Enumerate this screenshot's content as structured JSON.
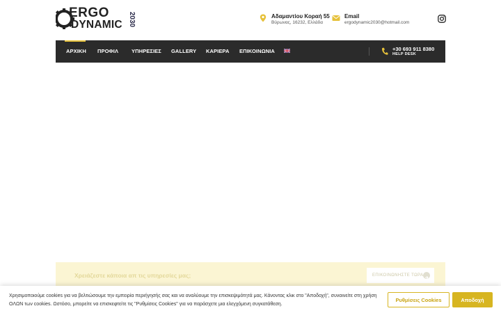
{
  "brand": {
    "line1": "ERGO",
    "line2": "DYNAMIC",
    "year": "2030",
    "accent": "#e6c13a"
  },
  "header": {
    "address": {
      "icon": "map-pin-icon",
      "title": "Αδαμαντίου Κοραή 55",
      "subtitle": "Βύρωνας, 16232, Ελλάδα"
    },
    "email": {
      "icon": "envelope-icon",
      "title": "Email",
      "subtitle": "ergodynamic2030@hotmail.com"
    },
    "social": {
      "icon": "instagram-icon"
    }
  },
  "nav": {
    "items": [
      {
        "label": "ΑΡΧΙΚΗ",
        "active": true
      },
      {
        "label": "ΠΡΟΦΙΛ"
      },
      {
        "label": "ΥΠΗΡΕΣΙΕΣ"
      },
      {
        "label": "GALLERY"
      },
      {
        "label": "ΚΑΡΙΕΡΑ"
      },
      {
        "label": "ΕΠΙΚΟΙΝΩΝΙΑ"
      }
    ],
    "language_icon": "uk-flag-icon",
    "phone": "+30 693 911 8380",
    "phone_caption": "HELP DESK",
    "bg": "#2b2b2b"
  },
  "cta": {
    "text": "Χρειάζεστε κάποια απ τις υπηρεσίες μας;",
    "button": "ΕΠΙΚΟΙΝΩΝΗΣΤΕ ΤΩΡΑ",
    "bg": "#fbf5d3"
  },
  "cookie": {
    "message": "Χρησιμοποιούμε cookies για να βελτιώσουμε την εμπειρία περιήγησής σας και να αναλύουμε την επισκεψιμότητά μας. Κάνοντας κλικ στο \"Αποδοχή\", συναινείτε στη χρήση ΟΛΩΝ των cookies. Ωστόσο, μπορείτε να επισκεφτείτε τις \"Ρυθμίσεις Cookies\" για να παράσχετε μια ελεγχόμενη συγκατάθεση.",
    "settings_label": "Ρυθμίσεις Cookies",
    "accept_label": "Αποδοχή",
    "button_color": "#d7b521"
  }
}
